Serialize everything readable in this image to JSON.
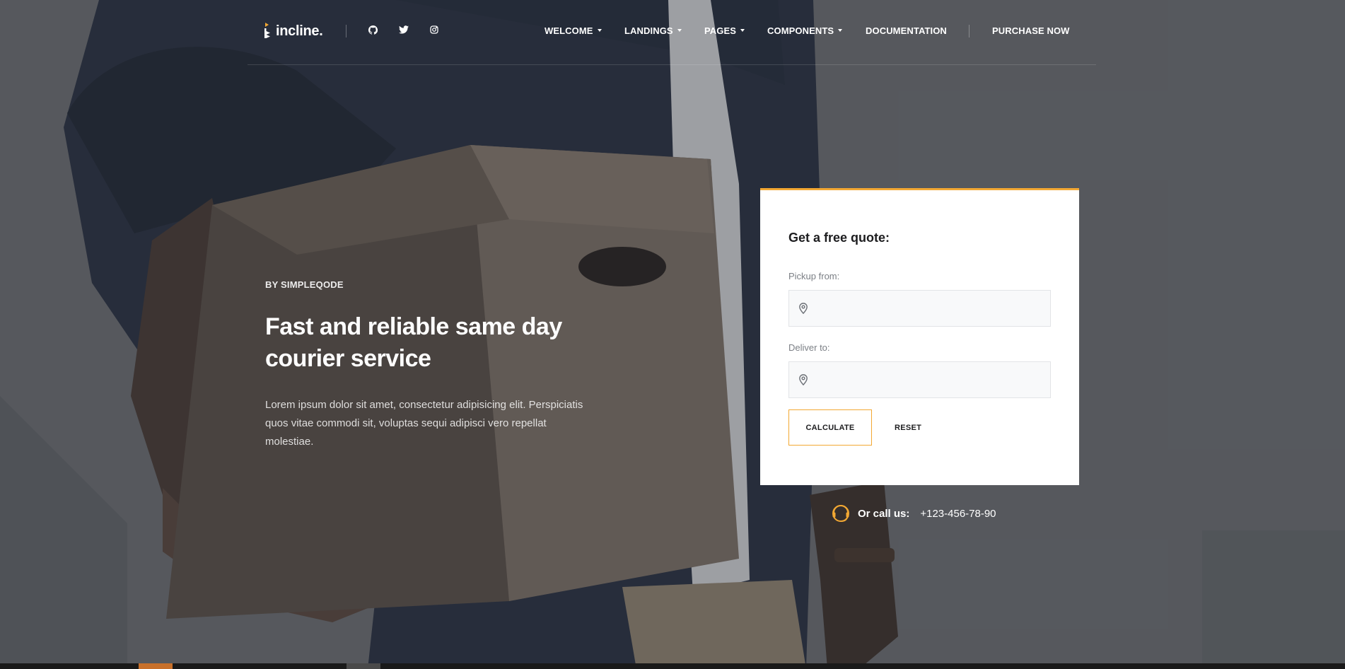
{
  "brand": {
    "name": "incline.",
    "accent_color": "#f3a833"
  },
  "social": [
    {
      "icon": "github-icon"
    },
    {
      "icon": "twitter-icon"
    },
    {
      "icon": "instagram-icon"
    }
  ],
  "nav": {
    "items": [
      {
        "label": "WELCOME",
        "dropdown": true
      },
      {
        "label": "LANDINGS",
        "dropdown": true
      },
      {
        "label": "PAGES",
        "dropdown": true
      },
      {
        "label": "COMPONENTS",
        "dropdown": true
      },
      {
        "label": "DOCUMENTATION",
        "dropdown": false
      }
    ],
    "cta": "PURCHASE NOW"
  },
  "hero": {
    "eyebrow": "BY SIMPLEQODE",
    "headline_line1": "Fast and reliable same day",
    "headline_line2": "courier service",
    "lead": "Lorem ipsum dolor sit amet, consectetur adipisicing elit. Perspiciatis quos vitae commodi sit, voluptas sequi adipisci vero repellat molestiae."
  },
  "quote": {
    "title": "Get a free quote:",
    "pickup_label": "Pickup from:",
    "pickup_value": "",
    "deliver_label": "Deliver to:",
    "deliver_value": "",
    "calculate_label": "CALCULATE",
    "reset_label": "RESET"
  },
  "contact": {
    "label": "Or call us:",
    "phone": "+123-456-78-90"
  }
}
